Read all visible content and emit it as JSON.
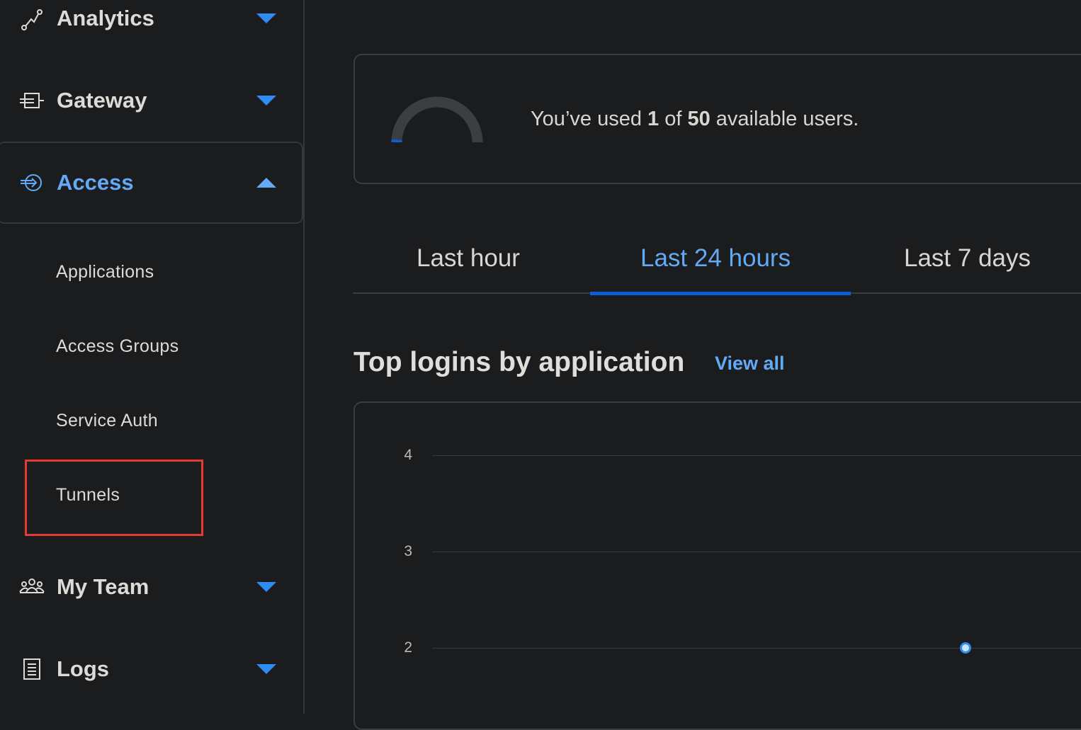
{
  "sidebar": {
    "items": [
      {
        "label": "Analytics",
        "icon": "analytics-icon",
        "expanded": false
      },
      {
        "label": "Gateway",
        "icon": "gateway-icon",
        "expanded": false
      },
      {
        "label": "Access",
        "icon": "access-icon",
        "expanded": true,
        "children": [
          "Applications",
          "Access Groups",
          "Service Auth",
          "Tunnels"
        ]
      },
      {
        "label": "My Team",
        "icon": "team-icon",
        "expanded": false
      },
      {
        "label": "Logs",
        "icon": "logs-icon",
        "expanded": false
      }
    ],
    "highlighted_item": "Tunnels"
  },
  "usage": {
    "prefix": "You’ve used ",
    "used": "1",
    "mid": " of ",
    "total": "50",
    "suffix": " available users.",
    "fraction": 0.02
  },
  "tabs": [
    {
      "label": "Last hour"
    },
    {
      "label": "Last 24 hours",
      "active": true
    },
    {
      "label": "Last 7 days"
    }
  ],
  "section": {
    "title": "Top logins by application",
    "view_all": "View all"
  },
  "colors": {
    "accent": "#2f8cf0",
    "active_text": "#63aaf5",
    "highlight": "#e53935",
    "background": "#1b1c1e"
  },
  "chart_data": {
    "type": "scatter",
    "yticks": [
      "4",
      "3",
      "2"
    ],
    "points": [
      {
        "y": 2
      }
    ],
    "grid": true
  }
}
